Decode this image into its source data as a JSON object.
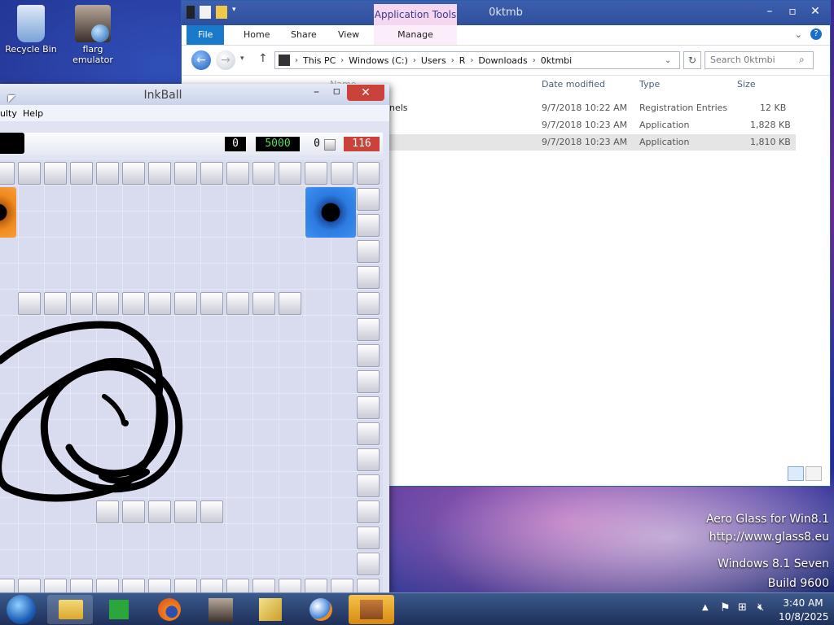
{
  "desktop": {
    "icons": [
      {
        "label": "Recycle Bin"
      },
      {
        "label": "flarg emulator"
      }
    ],
    "watermark": [
      "Aero Glass for Win8.1",
      "http://www.glass8.eu",
      "Windows 8.1 Seven",
      "Build 9600"
    ]
  },
  "explorer": {
    "title": "0ktmb",
    "context_tab": "Application Tools",
    "ribbon_tabs": [
      "File",
      "Home",
      "Share",
      "View",
      "Manage"
    ],
    "breadcrumb": [
      "This PC",
      "Windows (C:)",
      "Users",
      "R",
      "Downloads",
      "0ktmbi"
    ],
    "search_placeholder": "Search 0ktmbi",
    "columns": [
      "Name",
      "Date modified",
      "Type",
      "Size"
    ],
    "files": [
      {
        "name": "nnels",
        "date": "9/7/2018 10:22 AM",
        "type": "Registration Entries",
        "size": "12 KB"
      },
      {
        "name": "",
        "date": "9/7/2018 10:23 AM",
        "type": "Application",
        "size": "1,828 KB"
      },
      {
        "name": "",
        "date": "9/7/2018 10:23 AM",
        "type": "Application",
        "size": "1,810 KB"
      }
    ],
    "colors": {
      "ribbon_file": "#1979ca",
      "titlebar": "#3c5fae",
      "context": "#f5d8f0"
    }
  },
  "inkball": {
    "title": "InkBall",
    "menu": [
      "ulty",
      "Help"
    ],
    "scores": {
      "timer": "0",
      "goal": "5000",
      "caught_count": "0",
      "time_left": "116"
    },
    "colors": {
      "close": "#c9433a",
      "goal_text": "#3fbf3f",
      "time_bg": "#c9433a",
      "hole_blue": "#2b7be0",
      "hole_orange": "#f08a1e"
    }
  },
  "taskbar": {
    "clock_time": "3:40 AM",
    "clock_date": "10/8/2025",
    "apps": [
      "start",
      "explorer",
      "store",
      "firefox",
      "image",
      "folder-app",
      "paint-app",
      "network-app"
    ]
  }
}
